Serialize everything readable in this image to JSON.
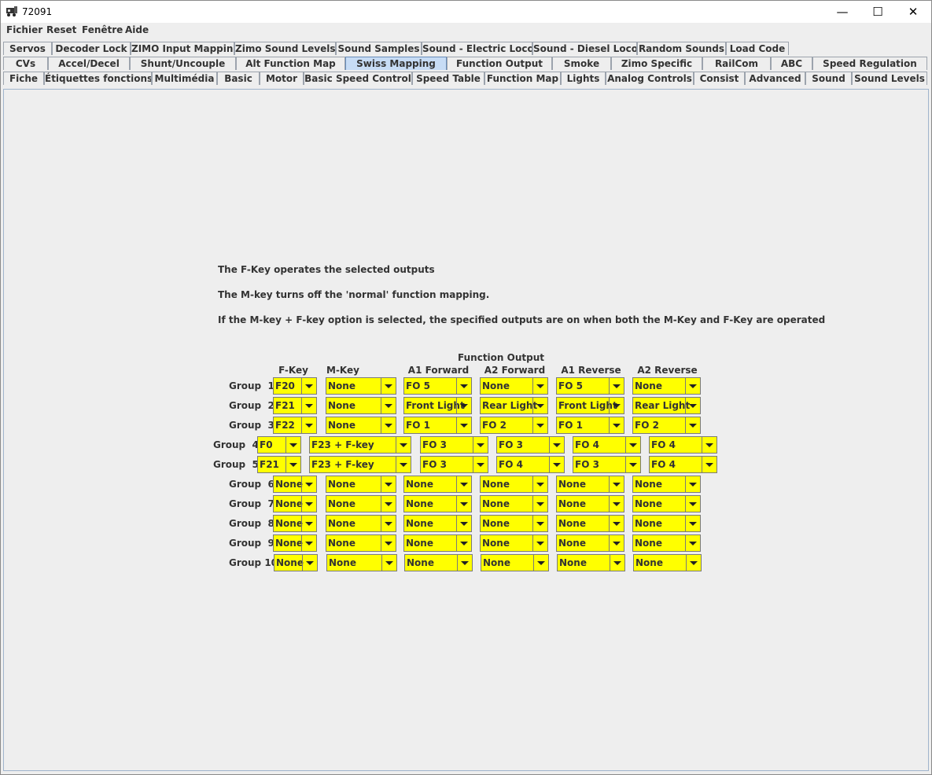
{
  "window": {
    "title": "72091"
  },
  "menu": [
    "Fichier",
    "Reset",
    "Fenêtre",
    "Aide"
  ],
  "tabs": {
    "row1": [
      "Servos",
      "Decoder Lock",
      "ZIMO Input Mapping",
      "Zimo Sound Levels",
      "Sound Samples",
      "Sound - Electric Loco",
      "Sound - Diesel Loco",
      "Random Sounds",
      "Load Code"
    ],
    "row2": [
      "CVs",
      "Accel/Decel",
      "Shunt/Uncouple",
      "Alt Function Map",
      "Swiss Mapping",
      "Function Output",
      "Smoke",
      "Zimo Specific",
      "RailCom",
      "ABC",
      "Speed Regulation"
    ],
    "row3": [
      "Fiche",
      "Étiquettes fonctions",
      "Multimédia",
      "Basic",
      "Motor",
      "Basic Speed Control",
      "Speed Table",
      "Function Map",
      "Lights",
      "Analog Controls",
      "Consist",
      "Advanced",
      "Sound",
      "Sound Levels"
    ],
    "selected": "Swiss Mapping"
  },
  "info": [
    "The F-Key operates the selected outputs",
    "The M-key turns off the 'normal' function mapping.",
    "If the M-key + F-key option is selected, the specified outputs are on when both the M-Key and F-Key are operated"
  ],
  "headers": {
    "function_output": "Function Output",
    "columns": [
      "F-Key",
      "M-Key",
      "A1 Forward",
      "A2 Forward",
      "A1 Reverse",
      "A2 Reverse"
    ]
  },
  "groups": [
    {
      "label": "Group  1",
      "values": [
        "F20",
        "None",
        "FO 5",
        "None",
        "FO 5",
        "None"
      ]
    },
    {
      "label": "Group  2",
      "values": [
        "F21",
        "None",
        "Front Light",
        "Rear Light",
        "Front Light",
        "Rear Light"
      ]
    },
    {
      "label": "Group  3",
      "values": [
        "F22",
        "None",
        "FO 1",
        "FO 2",
        "FO 1",
        "FO 2"
      ]
    },
    {
      "label": "Group  4",
      "values": [
        "F0",
        "F23 + F-key",
        "FO 3",
        "FO 3",
        "FO 4",
        "FO 4"
      ]
    },
    {
      "label": "Group  5",
      "values": [
        "F21",
        "F23 + F-key",
        "FO 3",
        "FO 4",
        "FO 3",
        "FO 4"
      ]
    },
    {
      "label": "Group  6",
      "values": [
        "None",
        "None",
        "None",
        "None",
        "None",
        "None"
      ]
    },
    {
      "label": "Group  7",
      "values": [
        "None",
        "None",
        "None",
        "None",
        "None",
        "None"
      ]
    },
    {
      "label": "Group  8",
      "values": [
        "None",
        "None",
        "None",
        "None",
        "None",
        "None"
      ]
    },
    {
      "label": "Group  9",
      "values": [
        "None",
        "None",
        "None",
        "None",
        "None",
        "None"
      ]
    },
    {
      "label": "Group 10",
      "values": [
        "None",
        "None",
        "None",
        "None",
        "None",
        "None"
      ]
    }
  ],
  "colors": {
    "combo_bg": "#ffff00",
    "selected_tab": "#c7dcf5"
  }
}
